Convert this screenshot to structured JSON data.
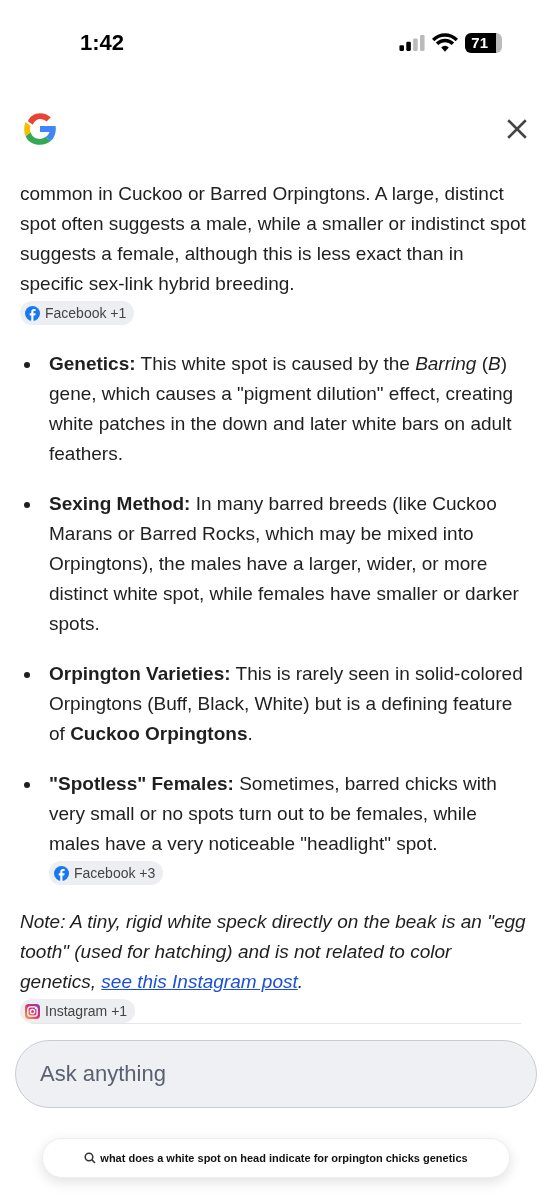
{
  "status_bar": {
    "time": "1:42",
    "battery": "71"
  },
  "intro": {
    "text": "common in Cuckoo or Barred Orpingtons. A large, distinct spot often suggests a male, while a smaller or indistinct spot suggests a female, although this is less exact than in specific sex-link hybrid breeding.",
    "chip": {
      "kind": "facebook",
      "label": "Facebook +1"
    }
  },
  "bullets": [
    {
      "text": "**Genetics:** This white spot is caused by the *Barring* (*B*) gene, which causes a \"pigment dilution\" effect, creating white patches in the down and later white bars on adult feathers."
    },
    {
      "text": "**Sexing Method:** In many barred breeds (like Cuckoo Marans or Barred Rocks, which may be mixed into Orpingtons), the males have a larger, wider, or more distinct white spot, while females have smaller or darker spots."
    },
    {
      "text": "**Orpington Varieties:** This is rarely seen in solid-colored Orpingtons (Buff, Black, White) but is a defining feature of **Cuckoo Orpingtons**."
    },
    {
      "text": "**\"Spotless\" Females:** Sometimes, barred chicks with very small or no spots turn out to be females, while males have a very noticeable \"headlight\" spot.",
      "chip": {
        "kind": "facebook",
        "label": "Facebook +3"
      }
    }
  ],
  "note": {
    "text": "Note: A tiny, rigid white speck directly on the beak is an \"egg tooth\" (used for hatching) and is not related to color genetics, ",
    "link": "see this Instagram post",
    "after": ".",
    "chip": {
      "kind": "instagram",
      "label": "Instagram +1"
    }
  },
  "ask": {
    "placeholder": "Ask anything"
  },
  "query": "what does a white spot on head indicate for orpington chicks genetics"
}
